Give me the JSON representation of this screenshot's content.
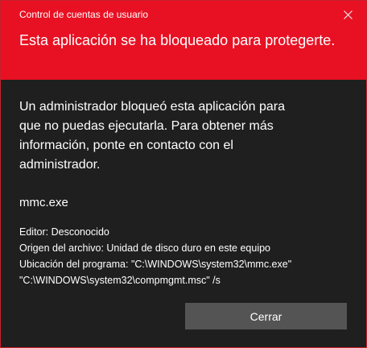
{
  "window": {
    "title": "Control de cuentas de usuario",
    "close_icon": "close-icon"
  },
  "header": {
    "headline": "Esta aplicación se ha bloqueado para protegerte.",
    "background_color": "#e81123"
  },
  "body": {
    "message": "Un administrador bloqueó esta aplicación para que no puedas ejecutarla. Para obtener más información, ponte en contacto con el administrador.",
    "program_name": "mmc.exe",
    "details": {
      "publisher": "Editor: Desconocido",
      "file_origin": "Origen del archivo: Unidad de disco duro en este equipo",
      "program_location": "Ubicación del programa: \"C:\\WINDOWS\\system32\\mmc.exe\" \"C:\\WINDOWS\\system32\\compmgmt.msc\" /s"
    }
  },
  "actions": {
    "close_label": "Cerrar"
  }
}
